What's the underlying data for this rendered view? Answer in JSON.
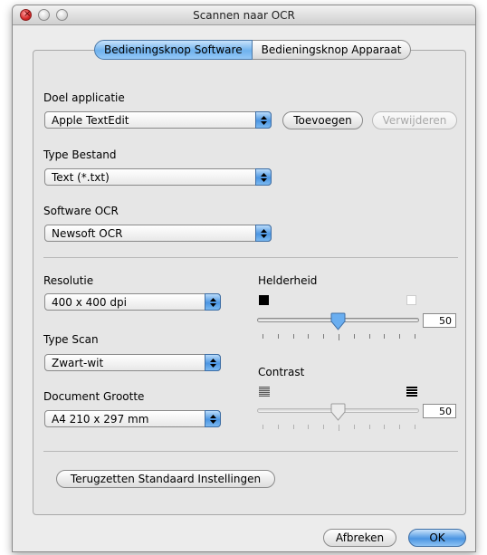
{
  "window": {
    "title": "Scannen naar OCR"
  },
  "tabs": [
    {
      "label": "Bedieningsknop Software",
      "active": true
    },
    {
      "label": "Bedieningsknop Apparaat",
      "active": false
    }
  ],
  "target_app": {
    "label": "Doel applicatie",
    "value": "Apple TextEdit",
    "add_label": "Toevoegen",
    "remove_label": "Verwijderen"
  },
  "file_type": {
    "label": "Type Bestand",
    "value": "Text (*.txt)"
  },
  "ocr_software": {
    "label": "Software OCR",
    "value": "Newsoft OCR"
  },
  "resolution": {
    "label": "Resolutie",
    "value": "400 x 400 dpi"
  },
  "scan_type": {
    "label": "Type Scan",
    "value": "Zwart-wit"
  },
  "document_size": {
    "label": "Document Grootte",
    "value": "A4 210 x 297 mm"
  },
  "brightness": {
    "label": "Helderheid",
    "value": "50",
    "level": 0.5,
    "enabled": true,
    "icon_low": "black-square-icon",
    "icon_high": "white-square-icon"
  },
  "contrast": {
    "label": "Contrast",
    "value": "50",
    "level": 0.5,
    "enabled": false,
    "icon_low": "low-contrast-icon",
    "icon_high": "high-contrast-icon"
  },
  "reset_label": "Terugzetten Standaard Instellingen",
  "footer": {
    "cancel_label": "Afbreken",
    "ok_label": "OK"
  },
  "colors": {
    "accent": "#4b95e2"
  }
}
